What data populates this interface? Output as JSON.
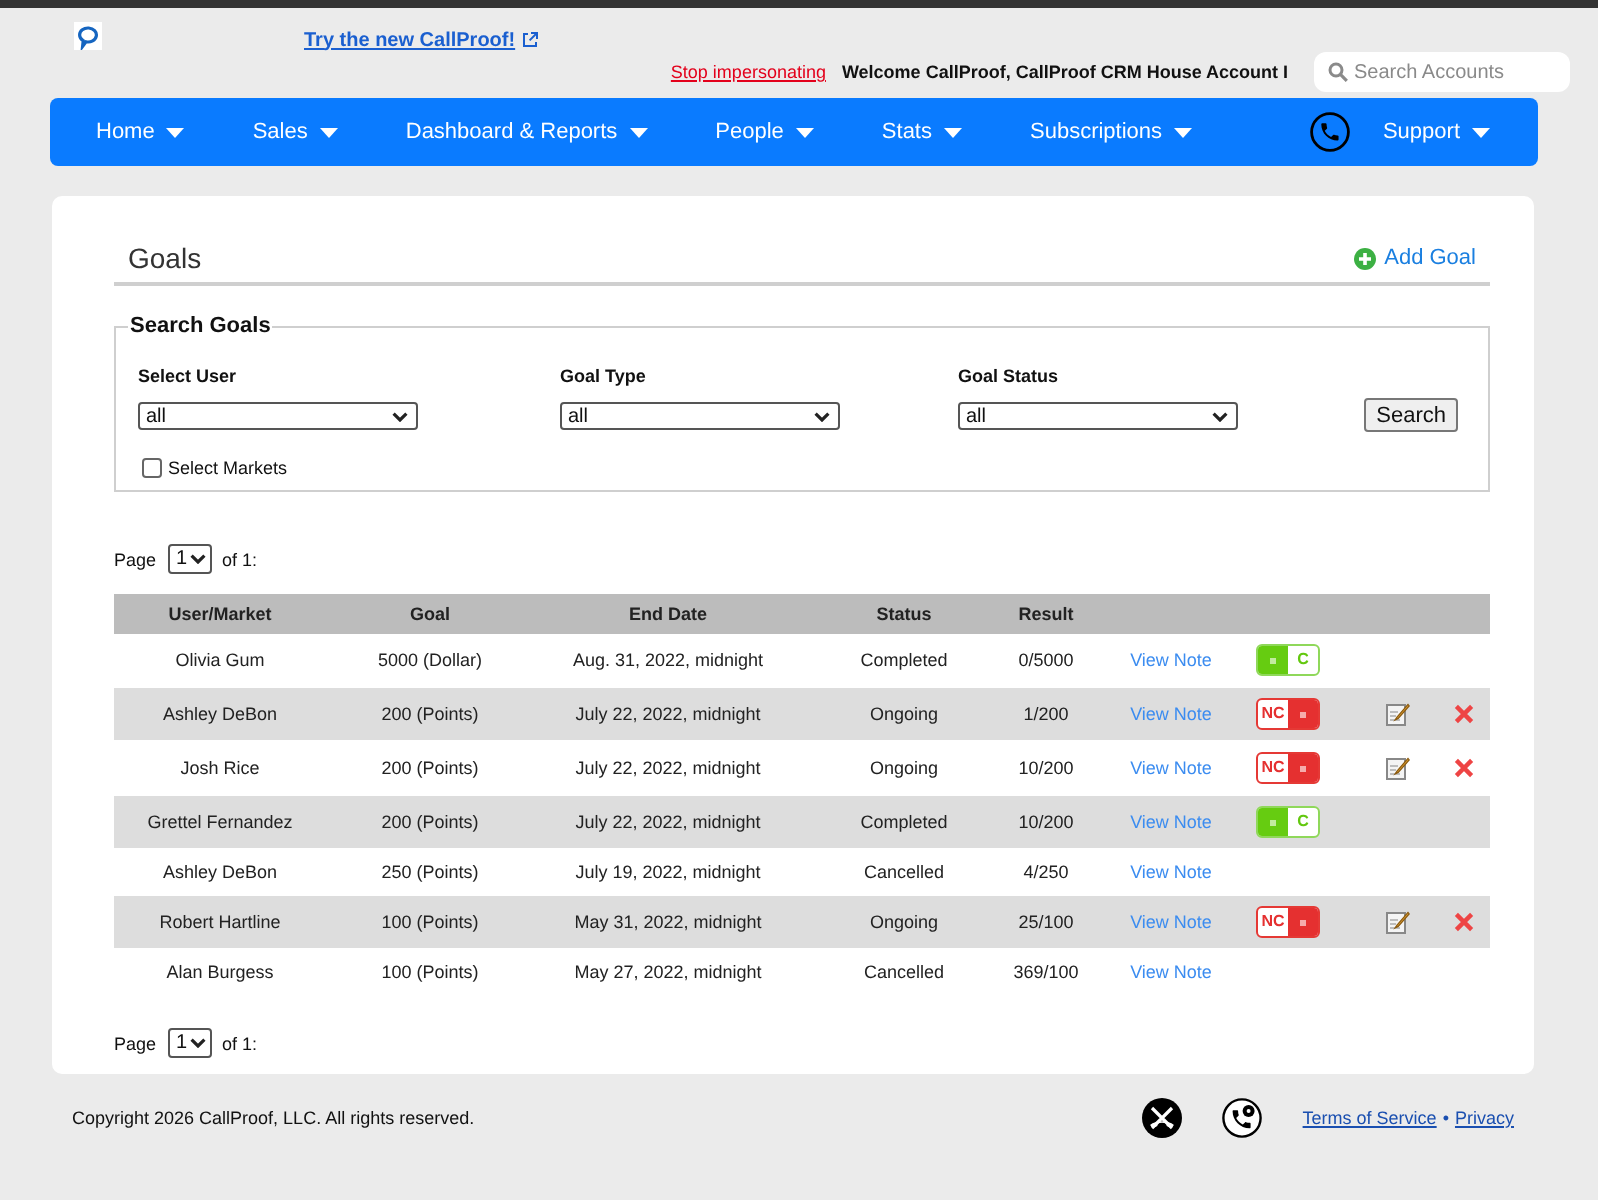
{
  "header": {
    "promo_link": "Try the new CallProof!",
    "stop_link": "Stop impersonating",
    "welcome": "Welcome CallProof, CallProof CRM House Account I",
    "search": {
      "placeholder": "Search Accounts"
    }
  },
  "nav": {
    "items": [
      {
        "kind": "menu",
        "label": "Home"
      },
      {
        "kind": "menu",
        "label": "Sales"
      },
      {
        "kind": "menu",
        "label": "Dashboard & Reports"
      },
      {
        "kind": "menu",
        "label": "People"
      },
      {
        "kind": "menu",
        "label": "Stats"
      },
      {
        "kind": "menu",
        "label": "Subscriptions"
      },
      {
        "kind": "phone"
      },
      {
        "kind": "menu",
        "label": "Support"
      }
    ]
  },
  "page": {
    "title": "Goals",
    "add_link": "Add Goal"
  },
  "search_form": {
    "legend": "Search Goals",
    "filters": [
      {
        "label": "Select User",
        "value": "all"
      },
      {
        "label": "Goal Type",
        "value": "all"
      },
      {
        "label": "Goal Status",
        "value": "all"
      }
    ],
    "button": "Search",
    "markets": {
      "label": "Select Markets",
      "checked": false
    }
  },
  "pager_top": {
    "prefix": "Page",
    "value": "1",
    "suffix": "of 1:"
  },
  "table": {
    "columns": [
      "User/Market",
      "Goal",
      "End Date",
      "Status",
      "Result"
    ],
    "rows": [
      {
        "user": "Olivia Gum",
        "goal": "5000 (Dollar)",
        "end_date": "Aug. 31, 2022, midnight",
        "status": "Completed",
        "result": "0/5000",
        "note": "View Note",
        "toggle": {
          "label": "C",
          "on": false
        },
        "editable": false
      },
      {
        "user": "Ashley DeBon",
        "goal": "200 (Points)",
        "end_date": "July 22, 2022, midnight",
        "status": "Ongoing",
        "result": "1/200",
        "note": "View Note",
        "toggle": {
          "label": "NC",
          "on": true
        },
        "editable": true
      },
      {
        "user": "Josh Rice",
        "goal": "200 (Points)",
        "end_date": "July 22, 2022, midnight",
        "status": "Ongoing",
        "result": "10/200",
        "note": "View Note",
        "toggle": {
          "label": "NC",
          "on": true
        },
        "editable": true
      },
      {
        "user": "Grettel Fernandez",
        "goal": "200 (Points)",
        "end_date": "July 22, 2022, midnight",
        "status": "Completed",
        "result": "10/200",
        "note": "View Note",
        "toggle": {
          "label": "C",
          "on": false
        },
        "editable": false
      },
      {
        "user": "Ashley DeBon",
        "goal": "250 (Points)",
        "end_date": "July 19, 2022, midnight",
        "status": "Cancelled",
        "result": "4/250",
        "note": "View Note",
        "editable": false
      },
      {
        "user": "Robert Hartline",
        "goal": "100 (Points)",
        "end_date": "May 31, 2022, midnight",
        "status": "Ongoing",
        "result": "25/100",
        "note": "View Note",
        "toggle": {
          "label": "NC",
          "on": true
        },
        "editable": true
      },
      {
        "user": "Alan Burgess",
        "goal": "100 (Points)",
        "end_date": "May 27, 2022, midnight",
        "status": "Cancelled",
        "result": "369/100",
        "note": "View Note",
        "editable": false
      }
    ]
  },
  "pager_bottom": {
    "prefix": "Page",
    "value": "1",
    "suffix": "of 1:"
  },
  "footer": {
    "copyright": "Copyright 2026 CallProof, LLC. All rights reserved.",
    "links": [
      "Terms of Service",
      "Privacy"
    ],
    "separator": "•"
  }
}
